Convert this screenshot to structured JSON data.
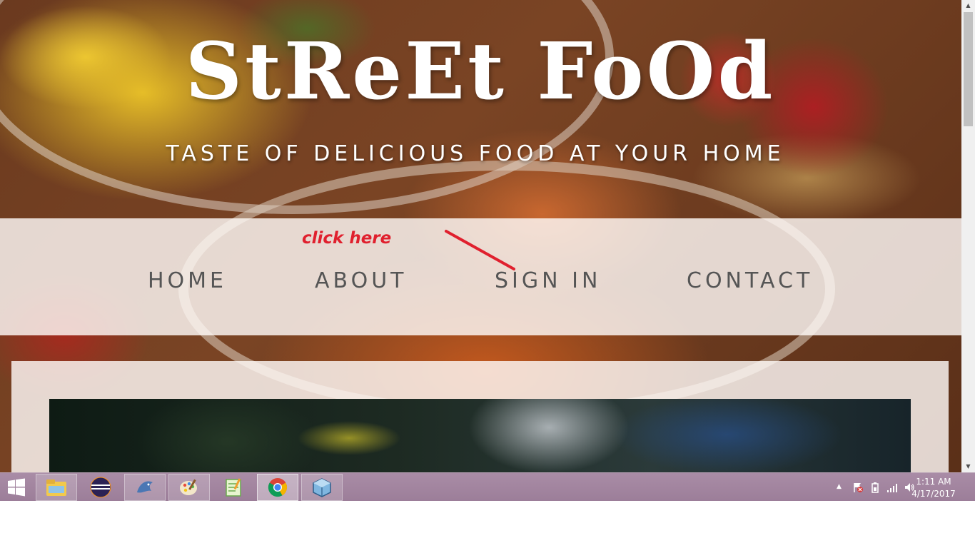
{
  "site": {
    "title": "StReEt FoOd",
    "tagline": "TASTE OF DELICIOUS FOOD AT YOUR HOME"
  },
  "nav": {
    "items": [
      {
        "label": "HOME"
      },
      {
        "label": "ABOUT"
      },
      {
        "label": "SIGN IN"
      },
      {
        "label": "CONTACT"
      }
    ]
  },
  "annotation": {
    "text": "click here",
    "color": "#e0202e"
  },
  "taskbar": {
    "apps": [
      {
        "icon": "file-explorer-icon"
      },
      {
        "icon": "eclipse-icon"
      },
      {
        "icon": "mysql-workbench-icon"
      },
      {
        "icon": "paint-icon"
      },
      {
        "icon": "notepad-plus-plus-icon"
      },
      {
        "icon": "chrome-icon",
        "active": true
      },
      {
        "icon": "virtualbox-icon"
      }
    ],
    "clock": {
      "time": "1:11 AM",
      "date": "4/17/2017"
    }
  },
  "colors": {
    "nav_text": "#555555",
    "taskbar": "#a98ca6"
  }
}
